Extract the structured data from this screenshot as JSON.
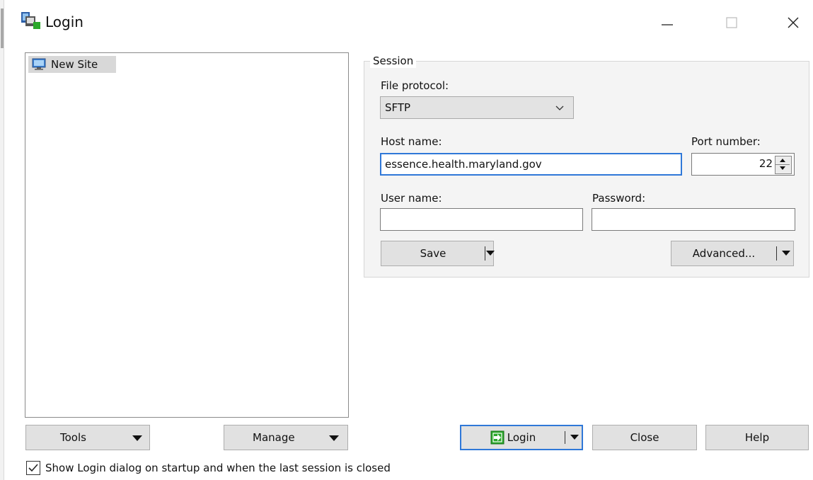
{
  "window": {
    "title": "Login"
  },
  "sites": [
    {
      "label": "New Site",
      "icon": "computer-icon"
    }
  ],
  "session": {
    "group_label": "Session",
    "file_protocol_label": "File protocol:",
    "file_protocol_value": "SFTP",
    "host_label": "Host name:",
    "host_value": "essence.health.maryland.gov",
    "port_label": "Port number:",
    "port_value": "22",
    "user_label": "User name:",
    "user_value": "",
    "password_label": "Password:",
    "password_value": "",
    "save_label": "Save",
    "advanced_label": "Advanced..."
  },
  "buttons": {
    "tools": "Tools",
    "manage": "Manage",
    "login": "Login",
    "close": "Close",
    "help": "Help"
  },
  "options": {
    "show_login_label": "Show Login dialog on startup and when the last session is closed",
    "show_login_checked": true
  },
  "colors": {
    "focus_border": "#2f78d8",
    "login_icon": "#2aa82a",
    "button_face": "#e1e1e1"
  }
}
